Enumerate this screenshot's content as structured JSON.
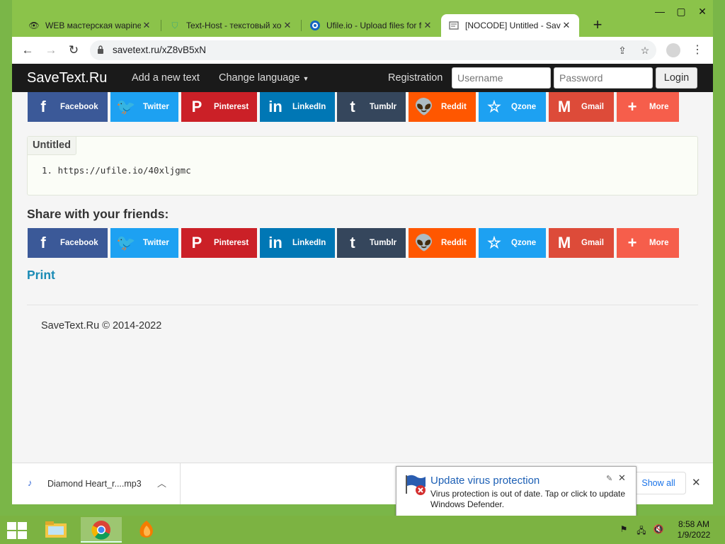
{
  "browser": {
    "tabs": [
      {
        "title": "WEB мастерская wapinet",
        "icon": "eye-icon",
        "active": false
      },
      {
        "title": "Text-Host - текстовый хостинг",
        "icon": "shield-icon",
        "active": false
      },
      {
        "title": "Ufile.io - Upload files for free",
        "icon": "ufile-icon",
        "active": false
      },
      {
        "title": "[NOCODE] Untitled - SaveText.Ru",
        "icon": "page-icon",
        "active": true
      }
    ],
    "url": "savetext.ru/xZ8vB5xN"
  },
  "site": {
    "brand": "SaveText.Ru",
    "nav_add": "Add a new text",
    "nav_language": "Change language",
    "nav_registration": "Registration",
    "username_placeholder": "Username",
    "password_placeholder": "Password",
    "login_label": "Login"
  },
  "share_buttons": [
    {
      "label": "Facebook",
      "icon": "facebook-icon",
      "color": "#3b5998"
    },
    {
      "label": "Twitter",
      "icon": "twitter-icon",
      "color": "#1da1f2"
    },
    {
      "label": "Pinterest",
      "icon": "pinterest-icon",
      "color": "#cb2027"
    },
    {
      "label": "LinkedIn",
      "icon": "linkedin-icon",
      "color": "#0077b5"
    },
    {
      "label": "Tumblr",
      "icon": "tumblr-icon",
      "color": "#35465c"
    },
    {
      "label": "Reddit",
      "icon": "reddit-icon",
      "color": "#ff5700"
    },
    {
      "label": "Qzone",
      "icon": "qzone-icon",
      "color": "#1da1f2"
    },
    {
      "label": "Gmail",
      "icon": "gmail-icon",
      "color": "#dd4b39"
    },
    {
      "label": "More",
      "icon": "plus-icon",
      "color": "#f65e4b"
    }
  ],
  "text_block": {
    "title": "Untitled",
    "line_number": "1.",
    "line": "https://ufile.io/40xljgmc"
  },
  "share_heading": "Share with your friends:",
  "print_label": "Print",
  "copyright": "SaveText.Ru © 2014-2022",
  "downloads": {
    "file_name": "Diamond Heart_r....mp3",
    "show_all": "Show all"
  },
  "notification": {
    "title": "Update virus protection",
    "text": "Virus protection is out of date. Tap or click to update Windows Defender."
  },
  "clock": {
    "time": "8:58 AM",
    "date": "1/9/2022"
  }
}
